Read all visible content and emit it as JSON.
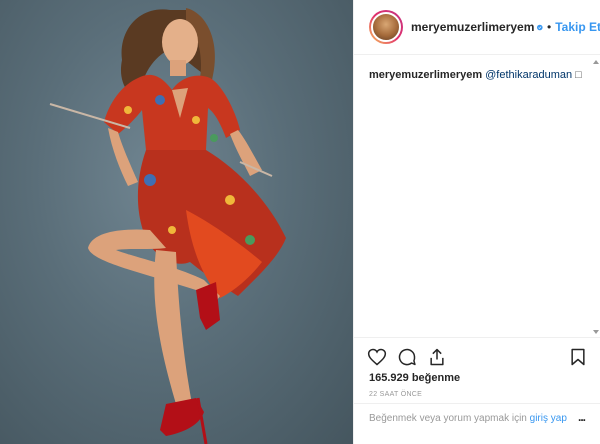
{
  "post": {
    "username": "meryemuzerlimeryem",
    "verified": true,
    "follow_label": "Takip Et",
    "separator": "•"
  },
  "caption": {
    "username": "meryemuzerlimeryem",
    "mention": "@fethikaraduman",
    "emoji": "□"
  },
  "actions": {
    "like_icon": "heart-icon",
    "comment_icon": "comment-icon",
    "share_icon": "share-icon",
    "save_icon": "bookmark-icon"
  },
  "likes": "165.929 beğenme",
  "timestamp": "22 SAAT ÖNCE",
  "footer": {
    "prompt": "Beğenmek veya yorum yapmak için",
    "login": "giriş yap",
    "more": "..."
  },
  "colors": {
    "link": "#3897f0",
    "background": "#5f737e",
    "dress": "#c8371f"
  }
}
